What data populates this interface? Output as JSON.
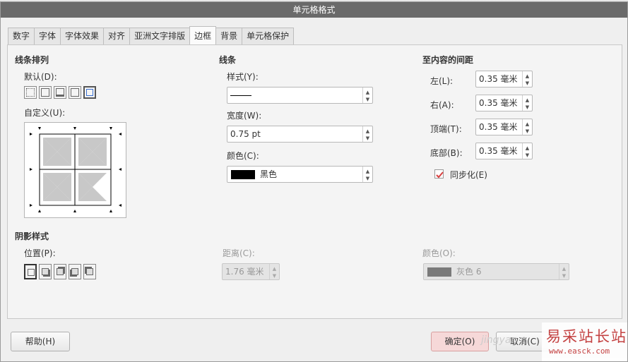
{
  "window": {
    "title": "单元格格式"
  },
  "tabs": [
    "数字",
    "字体",
    "字体效果",
    "对齐",
    "亚洲文字排版",
    "边框",
    "背景",
    "单元格保护"
  ],
  "arrangement": {
    "title": "线条排列",
    "default_label": "默认(D):",
    "custom_label": "自定义(U):"
  },
  "line": {
    "title": "线条",
    "style_label": "样式(Y):",
    "width_label": "宽度(W):",
    "width_value": "0.75 pt",
    "color_label": "颜色(C):",
    "color_value": "黑色",
    "color_hex": "#000000"
  },
  "padding": {
    "title": "至内容的间距",
    "left_label": "左(L):",
    "left_value": "0.35 毫米",
    "right_label": "右(A):",
    "right_value": "0.35 毫米",
    "top_label": "顶端(T):",
    "top_value": "0.35 毫米",
    "bottom_label": "底部(B):",
    "bottom_value": "0.35 毫米",
    "sync_label": "同步化(E)",
    "sync_checked": true
  },
  "shadow": {
    "title": "阴影样式",
    "position_label": "位置(P):",
    "distance_label": "距离(C):",
    "distance_value": "1.76 毫米",
    "color_label": "颜色(O):",
    "color_value": "灰色 6",
    "color_hex": "#7a7a7a"
  },
  "buttons": {
    "help": "帮助(H)",
    "ok": "确定(O)",
    "cancel": "取消(C)"
  },
  "watermark": {
    "text1": "易采站长站",
    "text2": "www.easck.com",
    "text3": "jingyan"
  }
}
